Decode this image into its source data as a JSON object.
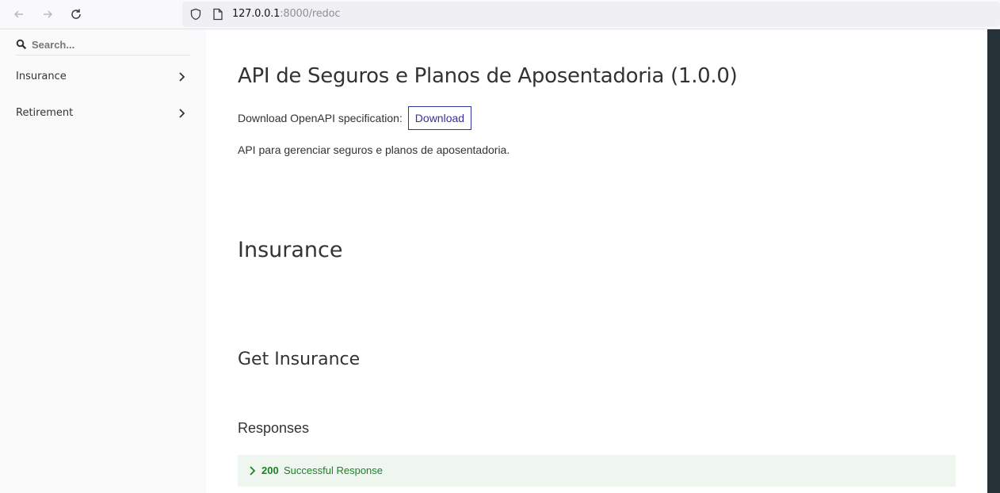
{
  "browser": {
    "url_host": "127.0.0.1",
    "url_path": ":8000/redoc",
    "icons": [
      "back-icon",
      "forward-icon",
      "reload-icon",
      "shield-icon",
      "page-icon"
    ]
  },
  "sidebar": {
    "search_placeholder": "Search...",
    "items": [
      {
        "label": "Insurance"
      },
      {
        "label": "Retirement"
      }
    ]
  },
  "main": {
    "title": "API de Seguros e Planos de Aposentadoria (1.0.0)",
    "download_label": "Download OpenAPI specification:",
    "download_button": "Download",
    "description": "API para gerenciar seguros e planos de aposentadoria.",
    "section_title": "Insurance",
    "operation_title": "Get Insurance",
    "responses_title": "Responses",
    "response": {
      "code": "200",
      "text": "Successful Response"
    }
  },
  "colors": {
    "accent": "#32329f",
    "success": "#1d8127",
    "success_bg": "#eef6ef",
    "right_panel": "#263238"
  }
}
